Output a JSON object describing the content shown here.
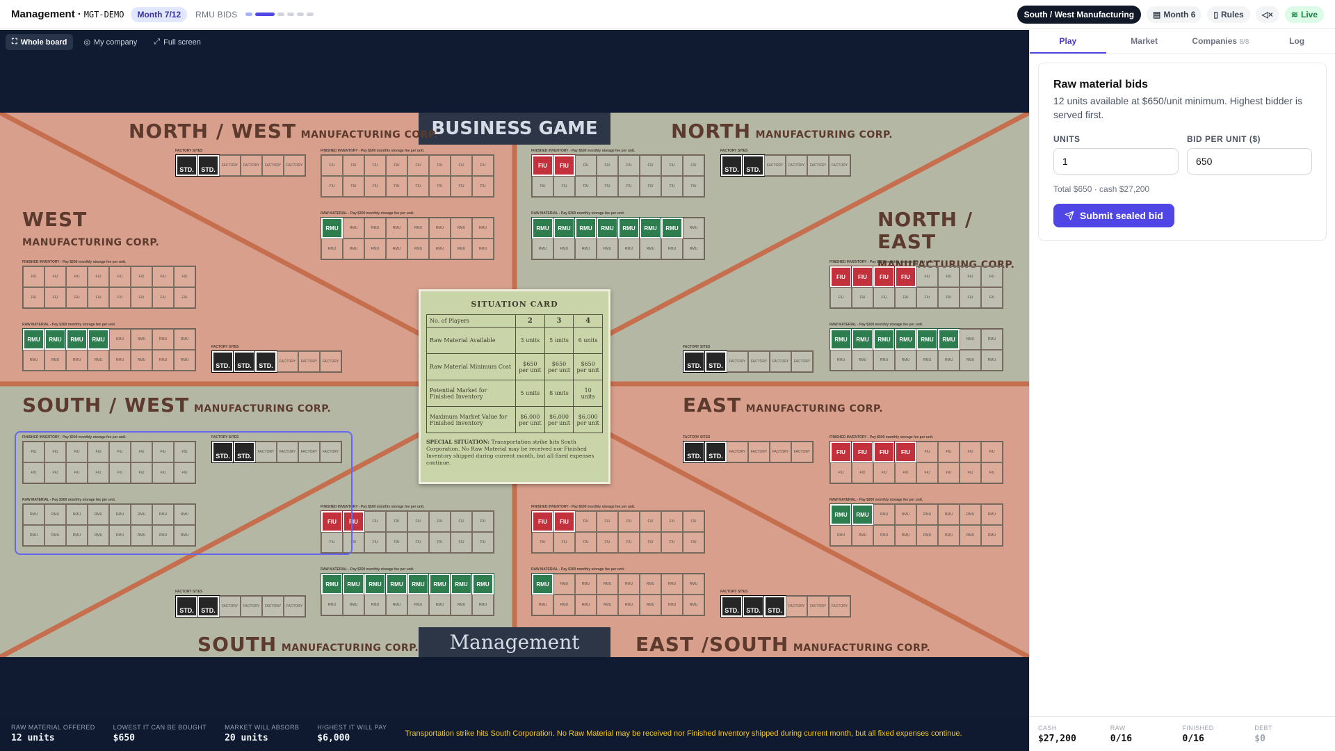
{
  "app": {
    "title": "Management",
    "game_code": "MGT-DEMO",
    "month_pill": "Month 7/12",
    "phase": "RMU BIDS"
  },
  "topbar": {
    "company": "South / West Manufacturing",
    "month": "Month 6",
    "rules": "Rules",
    "live": "Live"
  },
  "board_tools": {
    "whole_board": "Whole board",
    "my_company": "My company",
    "full_screen": "Full screen"
  },
  "board": {
    "game_title": "BUSINESS GAME",
    "bottom_title": "Management",
    "companies": {
      "nw": {
        "name": "NORTH / WEST",
        "sub": "MANUFACTURING CORP."
      },
      "n": {
        "name": "NORTH",
        "sub": "MANUFACTURING CORP."
      },
      "w": {
        "name": "WEST",
        "sub": "MANUFACTURING CORP."
      },
      "ne": {
        "name": "NORTH / EAST",
        "sub": "MANUFACTURING CORP."
      },
      "sw": {
        "name": "SOUTH / WEST",
        "sub": "MANUFACTURING CORP."
      },
      "e": {
        "name": "EAST",
        "sub": "MANUFACTURING CORP."
      },
      "s": {
        "name": "SOUTH",
        "sub": "MANUFACTURING CORP."
      },
      "es": {
        "name": "EAST /SOUTH",
        "sub": "MANUFACTURING CORP."
      }
    },
    "labels": {
      "factory": "FACTORY SITES",
      "fin": "FINISHED INVENTORY - Pay $500 monthly storage fee per unit.",
      "raw": "RAW MATERIAL - Pay $300 monthly storage fee per unit."
    },
    "cell_text": {
      "fiu": "FIU",
      "rmu": "RMU",
      "std": "STD.",
      "factory": "FACTORY"
    }
  },
  "situation_card": {
    "heading": "SITUATION CARD",
    "players_label": "No. of Players",
    "players": [
      "2",
      "3",
      "4"
    ],
    "rows": [
      {
        "label": "Raw Material Available",
        "values": [
          "3 units",
          "5 units",
          "6 units"
        ]
      },
      {
        "label": "Raw Material Minimum Cost",
        "values": [
          "$650 per unit",
          "$650 per unit",
          "$650 per unit"
        ]
      },
      {
        "label": "Potential Market for Finished Inventory",
        "values": [
          "5 units",
          "8 units",
          "10 units"
        ]
      },
      {
        "label": "Maximum Market Value for Finished Inventory",
        "values": [
          "$6,000 per unit",
          "$6,000 per unit",
          "$6,000 per unit"
        ]
      }
    ],
    "special_label": "SPECIAL SITUATION:",
    "special_text": "Transportation strike hits South Corporation. No Raw Material may be received nor Finished Inventory shipped during current month, but all fixed expenses continue."
  },
  "panel": {
    "tabs": [
      "Play",
      "Market",
      "Companies",
      "Log"
    ],
    "companies_count": "8/8",
    "bid": {
      "title": "Raw material bids",
      "description": "12 units available at $650/unit minimum. Highest bidder is served first.",
      "units_label": "UNITS",
      "units_value": "1",
      "bid_label": "BID PER UNIT ($)",
      "bid_value": "650",
      "total": "Total $650 · cash $27,200",
      "submit": "Submit sealed bid"
    }
  },
  "statusbar": {
    "raw_offered_label": "RAW MATERIAL OFFERED",
    "raw_offered": "12 units",
    "lowest_label": "LOWEST IT CAN BE BOUGHT",
    "lowest": "$650",
    "absorb_label": "MARKET WILL ABSORB",
    "absorb": "20 units",
    "highest_label": "HIGHEST IT WILL PAY",
    "highest": "$6,000",
    "situation": "Transportation strike hits South Corporation. No Raw Material may be received nor Finished Inventory shipped during current month, but all fixed expenses continue."
  },
  "player_stats": {
    "cash_label": "CASH",
    "cash": "$27,200",
    "raw_label": "RAW",
    "raw": "0/16",
    "finished_label": "FINISHED",
    "finished": "0/16",
    "debt_label": "DEBT",
    "debt": "$0"
  },
  "colors": {
    "accent": "#4f46e5",
    "board_bg": "#101a30",
    "board_salmon": "#d8a08c",
    "board_gray": "#b5b7a5",
    "fiu": "#c3323c",
    "rmu": "#2e7d4f"
  }
}
